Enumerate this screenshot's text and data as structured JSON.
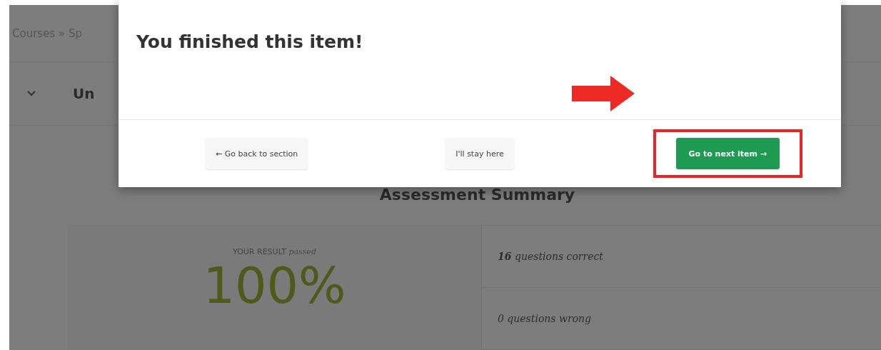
{
  "breadcrumb": {
    "text": "Courses » Sp"
  },
  "unit": {
    "title": "Un"
  },
  "summary": {
    "title": "Assessment Summary",
    "result_label": "YOUR RESULT",
    "result_status": "passed",
    "score": "100%",
    "stats": [
      "**16** questions correct",
      "0 questions wrong"
    ]
  },
  "modal": {
    "title": "You finished this item!",
    "buttons": [
      {
        "label": "← Go back to section",
        "kind": "secondary",
        "highlighted": false
      },
      {
        "label": "I'll stay here",
        "kind": "secondary",
        "highlighted": false
      },
      {
        "label": "Go to next item →",
        "kind": "primary",
        "highlighted": true
      }
    ]
  }
}
